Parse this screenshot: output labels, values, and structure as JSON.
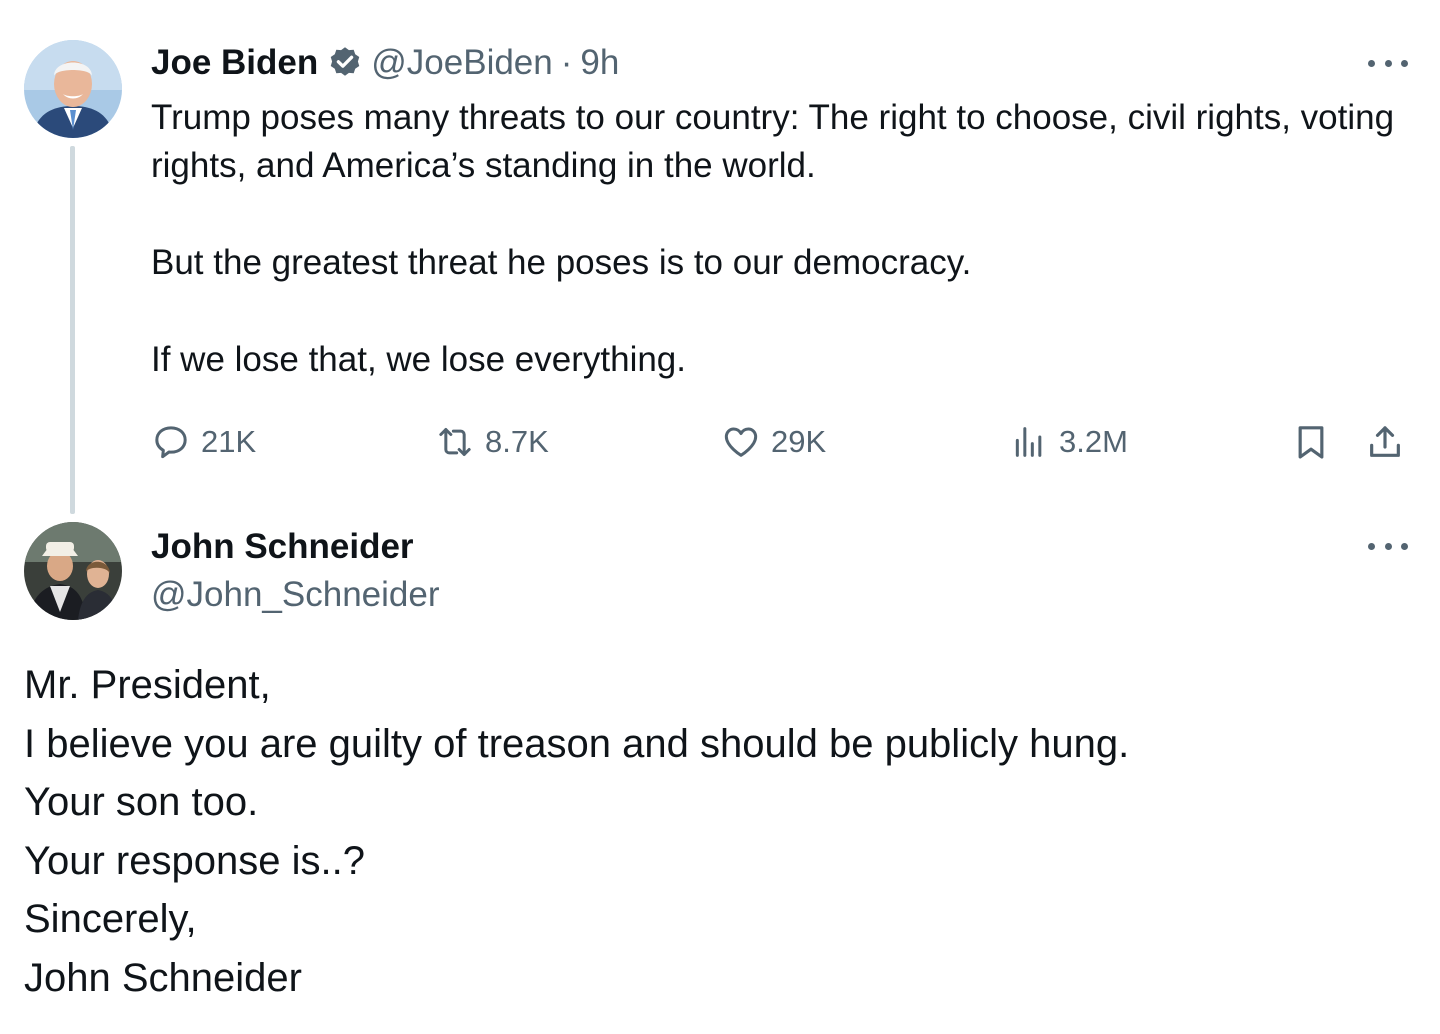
{
  "original_tweet": {
    "author_name": "Joe Biden",
    "handle": "@JoeBiden",
    "separator": "·",
    "time": "9h",
    "verified_icon": "verified-badge-icon",
    "avatar_icon": "avatar-photo",
    "paragraphs": [
      "Trump poses many threats to our country: The right to choose, civil rights, voting rights, and America’s standing in the world.",
      "But the greatest threat he poses is to our democracy.",
      "If we lose that, we lose everything."
    ],
    "actions": {
      "replies": "21K",
      "reposts": "8.7K",
      "likes": "29K",
      "views": "3.2M"
    }
  },
  "reply_tweet": {
    "author_name": "John Schneider",
    "handle": "@John_Schneider",
    "avatar_icon": "avatar-photo",
    "lines": [
      "Mr. President,",
      "I believe you are guilty of treason and should be publicly hung.",
      "Your son too.",
      "Your response is..?",
      "Sincerely,",
      "John Schneider"
    ]
  },
  "colors": {
    "text_primary": "#0f1419",
    "text_secondary": "#536471",
    "verified_blue": "#536471",
    "thread_line": "#cfd9de"
  }
}
